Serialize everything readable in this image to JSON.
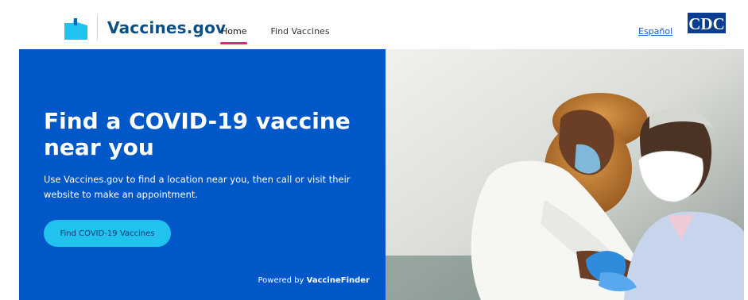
{
  "header": {
    "brand": "Vaccines.gov",
    "nav": [
      {
        "label": "Home",
        "active": true
      },
      {
        "label": "Find Vaccines",
        "active": false
      }
    ],
    "language_link": "Español",
    "agency_logo": "CDC"
  },
  "hero": {
    "title": "Find a COVID-19 vaccine near you",
    "description": "Use Vaccines.gov to find a location near you, then call or visit their website to make an appointment.",
    "cta": "Find COVID-19 Vaccines",
    "powered_prefix": "Powered by",
    "powered_brand": "VaccineFinder"
  },
  "colors": {
    "brand_blue": "#0057c8",
    "cta_cyan": "#22c2ee",
    "active_tab": "#e2247a",
    "link_blue": "#1d57d8",
    "wordmark_blue": "#0b4f86"
  },
  "icons": [
    "vaccines-gov-logo-icon",
    "cdc-logo"
  ]
}
